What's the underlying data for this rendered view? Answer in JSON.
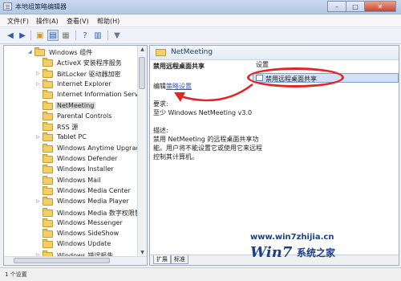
{
  "window": {
    "title": "本地组策略编辑器"
  },
  "menu": [
    "文件(F)",
    "操作(A)",
    "查看(V)",
    "帮助(H)"
  ],
  "tree": {
    "items": [
      {
        "label": "Windows 组件",
        "expanded": true
      },
      {
        "label": "ActiveX 安装程序服务"
      },
      {
        "label": "BitLocker 驱动器加密",
        "expandable": true
      },
      {
        "label": "Internet Explorer",
        "expandable": true
      },
      {
        "label": "Internet Information Servic"
      },
      {
        "label": "NetMeeting",
        "selected": true
      },
      {
        "label": "Parental Controls"
      },
      {
        "label": "RSS 源"
      },
      {
        "label": "Tablet PC",
        "expandable": true
      },
      {
        "label": "Windows Anytime Upgrade"
      },
      {
        "label": "Windows Defender"
      },
      {
        "label": "Windows Installer"
      },
      {
        "label": "Windows Mail"
      },
      {
        "label": "Windows Media Center"
      },
      {
        "label": "Windows Media Player",
        "expandable": true
      },
      {
        "label": "Windows Media 数字权限管"
      },
      {
        "label": "Windows Messenger"
      },
      {
        "label": "Windows SideShow"
      },
      {
        "label": "Windows Update"
      },
      {
        "label": "Windows 错误报告",
        "expandable": true
      }
    ]
  },
  "detail": {
    "folder_title": "NetMeeting",
    "setting_name": "禁用远程桌面共享",
    "edit_prefix": "编辑",
    "edit_link": "策略设置",
    "requirement_label": "要求:",
    "requirement_value": "至少 Windows NetMeeting v3.0",
    "description_label": "描述:",
    "description_lines": [
      "禁用 NetMeeting 的远程桌面共享功",
      "能。用户将不能设置它或使用它来远程",
      "控制其计算机。"
    ],
    "list_header": "设置",
    "list_item": "禁用远程桌面共享",
    "tabs": [
      "扩展",
      "标准"
    ]
  },
  "watermark": {
    "url": "www.win7zhijia.cn",
    "logo": "Win7",
    "name": "系统之家"
  },
  "status": {
    "text": "1 个设置"
  },
  "colors": {
    "annotation": "#e0262b",
    "selection": "#cfe2fb",
    "link": "#3b4fd0"
  }
}
